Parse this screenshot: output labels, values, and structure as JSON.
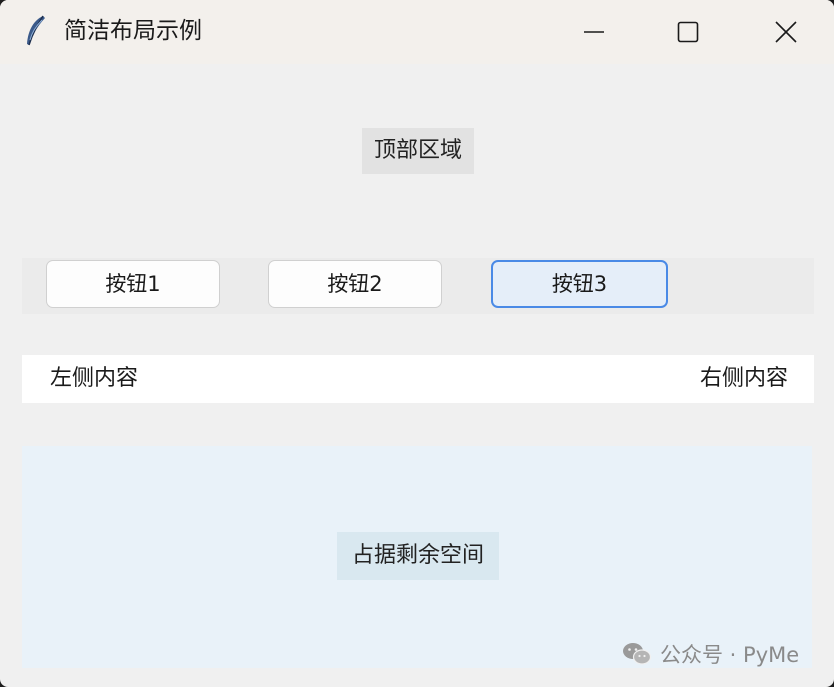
{
  "window": {
    "title": "简洁布局示例",
    "controls": {
      "minimize_icon": "minimize-icon",
      "maximize_icon": "maximize-icon",
      "close_icon": "close-icon"
    }
  },
  "top": {
    "label": "顶部区域"
  },
  "buttons": [
    {
      "label": "按钮1",
      "state": "normal"
    },
    {
      "label": "按钮2",
      "state": "normal"
    },
    {
      "label": "按钮3",
      "state": "focused"
    }
  ],
  "side_row": {
    "left": "左侧内容",
    "right": "右侧内容"
  },
  "fill": {
    "label": "占据剩余空间"
  },
  "watermark": {
    "text": "公众号 · PyMe",
    "icon": "wechat-icon"
  },
  "colors": {
    "focus_border": "#4a8ae6",
    "focus_bg": "#e5eef9",
    "fill_bg": "#e9f2f9"
  }
}
